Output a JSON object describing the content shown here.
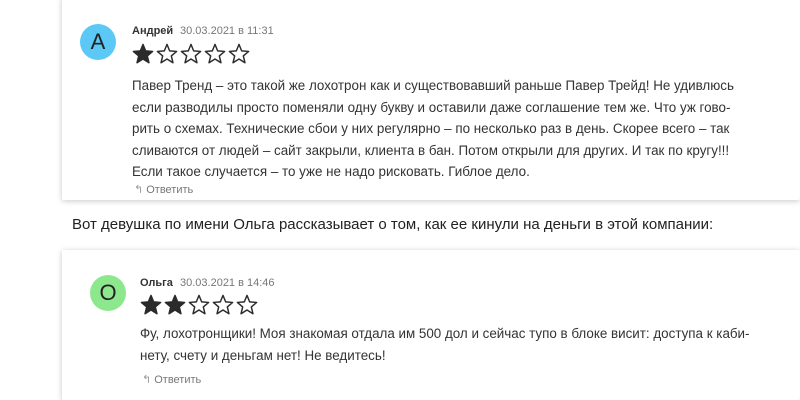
{
  "comments": [
    {
      "avatar_letter": "А",
      "avatar_color": "#5bc8f5",
      "author": "Андрей",
      "date": "30.03.2021 в 11:31",
      "rating": 1,
      "rating_max": 5,
      "lines": [
        "Павер Тренд – это такой же лохотрон как и существовавший раньше Павер Трейд! Не удивлюсь",
        "если разводилы просто поменяли одну букву и оставили даже соглашение тем же. Что уж гово-",
        "рить о схемах. Технические сбои у них регулярно – по несколько раз в день. Скорее всего – так",
        "сливаются от людей – сайт закрыли, клиента в бан. Потом открыли для других. И так по кругу!!!",
        "Если такое случается – то уже не надо рисковать. Гиблое дело."
      ],
      "reply_label": "Ответить"
    },
    {
      "avatar_letter": "О",
      "avatar_color": "#8de88d",
      "author": "Ольга",
      "date": "30.03.2021 в 14:46",
      "rating": 2,
      "rating_max": 5,
      "lines": [
        "Фу, лохотронщики! Моя знакомая отдала им 500 дол и сейчас тупо в блоке висит: доступа к каби-",
        "нету, счету и деньгам нет! Не ведитесь!"
      ],
      "reply_label": "Ответить"
    }
  ],
  "intro_text": "Вот девушка по имени Ольга рассказывает о том, как ее кинули на деньги в этой компании:",
  "icons": {
    "reply": "reply-arrow-icon",
    "star_filled": "star-filled-icon",
    "star_empty": "star-empty-icon"
  },
  "colors": {
    "star": "#2b2b2b"
  }
}
